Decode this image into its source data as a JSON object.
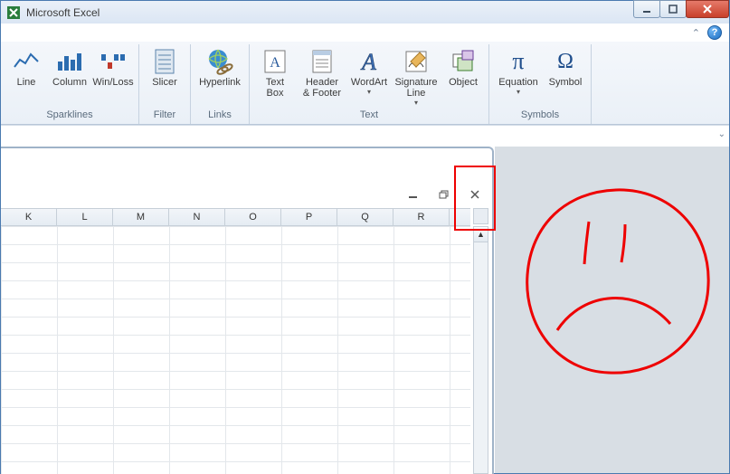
{
  "app": {
    "title": "Microsoft Excel"
  },
  "ribbon": {
    "groups": {
      "sparklines": {
        "label": "Sparklines",
        "line": "Line",
        "column": "Column",
        "winloss": "Win/Loss"
      },
      "filter": {
        "label": "Filter",
        "slicer": "Slicer"
      },
      "links": {
        "label": "Links",
        "hyperlink": "Hyperlink"
      },
      "text": {
        "label": "Text",
        "textbox": "Text\nBox",
        "headerfooter": "Header\n& Footer",
        "wordart": "WordArt",
        "signature": "Signature\nLine",
        "object": "Object"
      },
      "symbols": {
        "label": "Symbols",
        "equation": "Equation",
        "symbol": "Symbol"
      }
    }
  },
  "columns": [
    "K",
    "L",
    "M",
    "N",
    "O",
    "P",
    "Q",
    "R"
  ],
  "window": {
    "minimize": "Minimize",
    "maximize": "Maximize",
    "close": "Close"
  }
}
